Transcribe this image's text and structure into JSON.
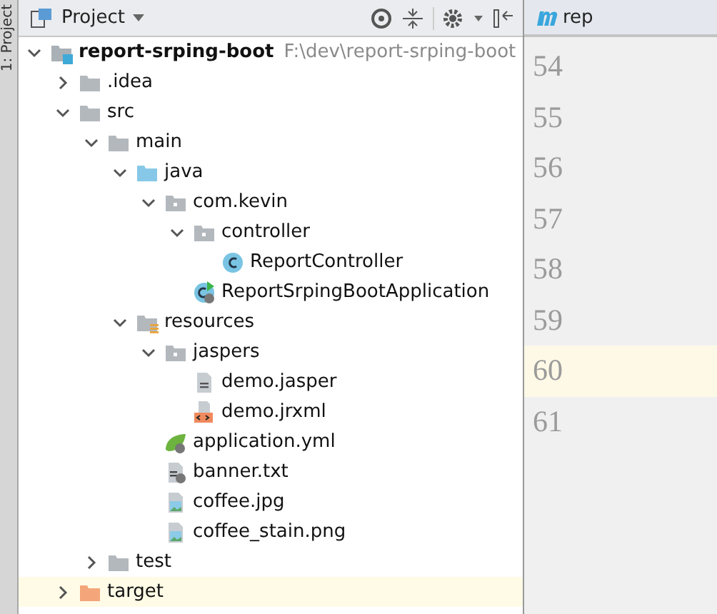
{
  "tool_strip": {
    "label": "1: Project"
  },
  "panel": {
    "title": "Project"
  },
  "tree": [
    {
      "name": "report-srping-boot",
      "path": "F:\\dev\\report-srping-boot",
      "kind": "module",
      "expanded": true,
      "highlighted": false,
      "children": [
        {
          "name": ".idea",
          "kind": "folder",
          "expanded": false,
          "highlighted": false
        },
        {
          "name": "src",
          "kind": "folder",
          "expanded": true,
          "highlighted": false,
          "children": [
            {
              "name": "main",
              "kind": "folder",
              "expanded": true,
              "highlighted": false,
              "children": [
                {
                  "name": "java",
                  "kind": "source",
                  "expanded": true,
                  "highlighted": false,
                  "children": [
                    {
                      "name": "com.kevin",
                      "kind": "package",
                      "expanded": true,
                      "highlighted": false,
                      "children": [
                        {
                          "name": "controller",
                          "kind": "package",
                          "expanded": true,
                          "highlighted": false,
                          "children": [
                            {
                              "name": "ReportController",
                              "kind": "class",
                              "highlighted": false
                            }
                          ]
                        },
                        {
                          "name": "ReportSrpingBootApplication",
                          "kind": "boot",
                          "highlighted": false
                        }
                      ]
                    }
                  ]
                },
                {
                  "name": "resources",
                  "kind": "resources",
                  "expanded": true,
                  "highlighted": false,
                  "children": [
                    {
                      "name": "jaspers",
                      "kind": "package",
                      "expanded": true,
                      "highlighted": false,
                      "children": [
                        {
                          "name": "demo.jasper",
                          "kind": "text",
                          "highlighted": false
                        },
                        {
                          "name": "demo.jrxml",
                          "kind": "xml",
                          "highlighted": false
                        }
                      ]
                    },
                    {
                      "name": "application.yml",
                      "kind": "spring",
                      "highlighted": false
                    },
                    {
                      "name": "banner.txt",
                      "kind": "banner",
                      "highlighted": false
                    },
                    {
                      "name": "coffee.jpg",
                      "kind": "image",
                      "highlighted": false
                    },
                    {
                      "name": "coffee_stain.png",
                      "kind": "image",
                      "highlighted": false
                    }
                  ]
                }
              ]
            },
            {
              "name": "test",
              "kind": "folder",
              "expanded": false,
              "highlighted": false
            }
          ]
        },
        {
          "name": "target",
          "kind": "excluded",
          "expanded": false,
          "highlighted": true
        }
      ]
    }
  ],
  "editor": {
    "tab": "rep",
    "lines": [
      {
        "number": "54",
        "current": false
      },
      {
        "number": "55",
        "current": false
      },
      {
        "number": "56",
        "current": false
      },
      {
        "number": "57",
        "current": false
      },
      {
        "number": "58",
        "current": false
      },
      {
        "number": "59",
        "current": false
      },
      {
        "number": "60",
        "current": true
      },
      {
        "number": "61",
        "current": false
      }
    ]
  }
}
